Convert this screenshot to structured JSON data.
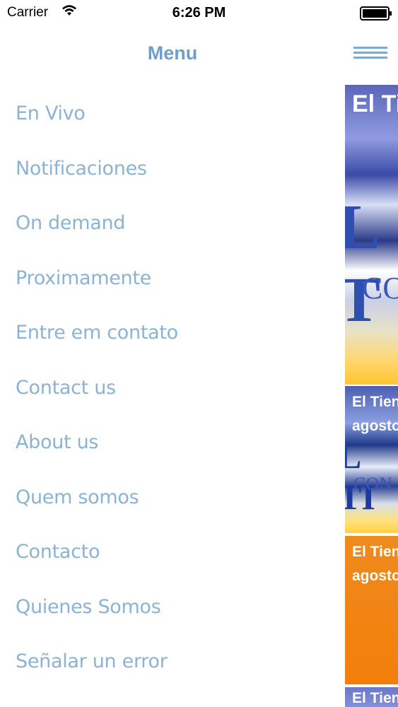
{
  "status_bar": {
    "carrier": "Carrier",
    "time": "6:26 PM"
  },
  "header": {
    "title": "Menu"
  },
  "menu": {
    "items": [
      {
        "label": "En Vivo"
      },
      {
        "label": "Notificaciones"
      },
      {
        "label": "On demand"
      },
      {
        "label": "Proximamente"
      },
      {
        "label": "Entre em contato"
      },
      {
        "label": "Contact us"
      },
      {
        "label": "About us"
      },
      {
        "label": "Quem somos"
      },
      {
        "label": "Contacto"
      },
      {
        "label": "Quienes Somos"
      },
      {
        "label": "Señalar un error"
      }
    ]
  },
  "content": {
    "cards": [
      {
        "title": "El Ti"
      },
      {
        "title_line1": "El Tien",
        "title_line2": "agosto"
      },
      {
        "title_line1": "El Tien",
        "title_line2": "agosto"
      },
      {
        "title": "El Tien"
      }
    ],
    "card_text": {
      "logo1": "L T",
      "logo1_sub": "CO",
      "logo2": "L TI",
      "logo2_sub": "CON"
    }
  },
  "colors": {
    "accent": "#6f9fc9",
    "menu_text": "#8cb3d3",
    "orange_card": "#f47f0a"
  }
}
